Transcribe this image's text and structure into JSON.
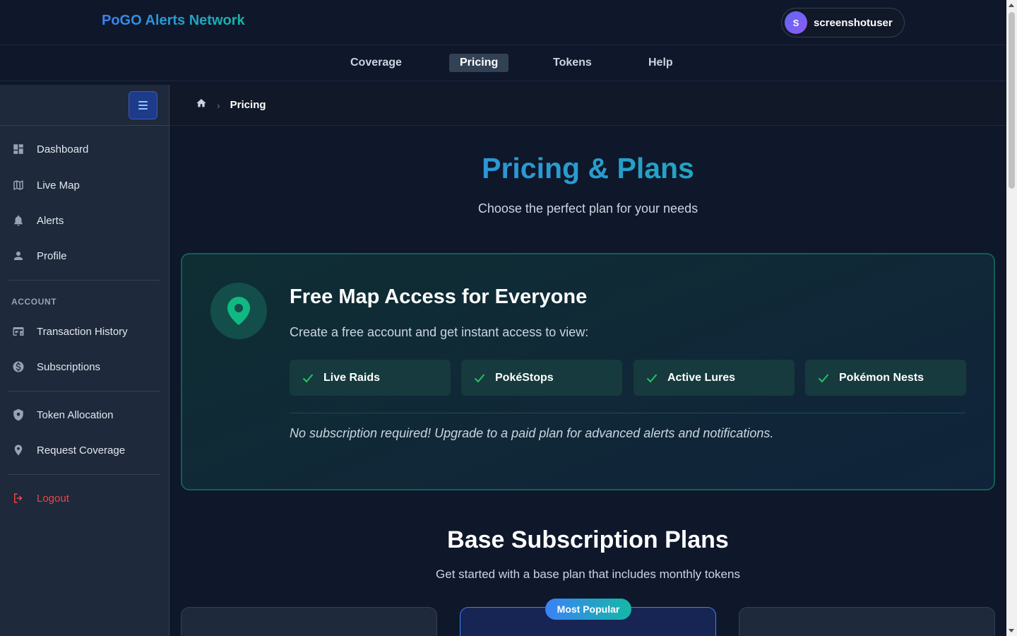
{
  "app": {
    "brand": "PoGO Alerts Network"
  },
  "user": {
    "initial": "S",
    "name": "screenshotuser"
  },
  "nav": {
    "tabs": [
      {
        "label": "Coverage",
        "active": false
      },
      {
        "label": "Pricing",
        "active": true
      },
      {
        "label": "Tokens",
        "active": false
      },
      {
        "label": "Help",
        "active": false
      }
    ]
  },
  "sidebar": {
    "items": [
      {
        "label": "Dashboard",
        "icon": "dashboard-icon"
      },
      {
        "label": "Live Map",
        "icon": "map-icon"
      },
      {
        "label": "Alerts",
        "icon": "bell-icon"
      },
      {
        "label": "Profile",
        "icon": "user-icon"
      }
    ],
    "account_section": "ACCOUNT",
    "account_items": [
      {
        "label": "Transaction History",
        "icon": "receipt-icon"
      },
      {
        "label": "Subscriptions",
        "icon": "dollar-icon"
      }
    ],
    "extra_items": [
      {
        "label": "Token Allocation",
        "icon": "shield-icon"
      },
      {
        "label": "Request Coverage",
        "icon": "pin-icon"
      }
    ],
    "logout": "Logout",
    "logout_color": "#ef4444"
  },
  "breadcrumb": {
    "current": "Pricing"
  },
  "page": {
    "title": "Pricing & Plans",
    "subtitle": "Choose the perfect plan for your needs"
  },
  "free_access": {
    "title": "Free Map Access for Everyone",
    "description": "Create a free account and get instant access to view:",
    "features": [
      "Live Raids",
      "PokéStops",
      "Active Lures",
      "Pokémon Nests"
    ],
    "note": "No subscription required! Upgrade to a paid plan for advanced alerts and notifications."
  },
  "plans": {
    "title": "Base Subscription Plans",
    "subtitle": "Get started with a base plan that includes monthly tokens",
    "popular_badge": "Most Popular"
  },
  "colors": {
    "accent_blue": "#3b82f6",
    "accent_teal": "#14b8a6",
    "check_green": "#22c55e"
  }
}
